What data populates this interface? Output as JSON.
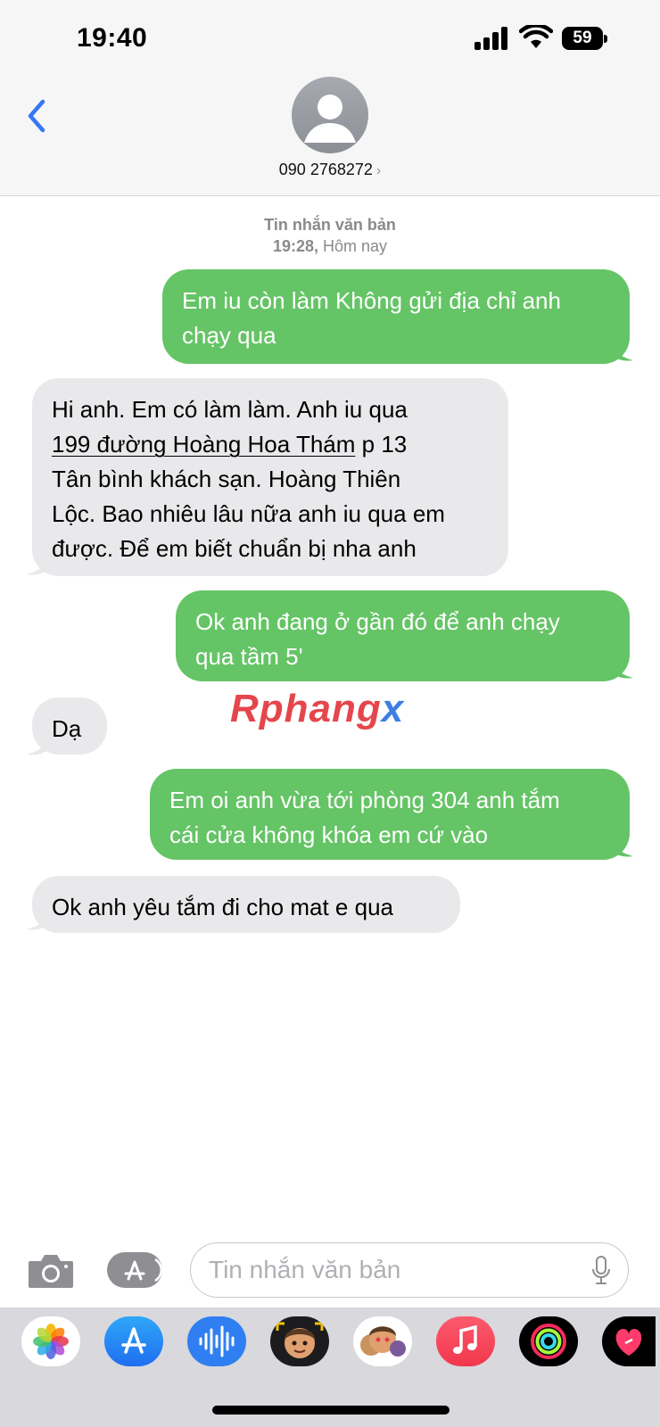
{
  "status_bar": {
    "time": "19:40",
    "battery": "59"
  },
  "header": {
    "contact": "090 2768272",
    "chevron": "›"
  },
  "timestamp": {
    "service": "Tin nhắn văn bản",
    "time_prefix": "19:28,",
    "time_day": "Hôm nay"
  },
  "messages": [
    {
      "dir": "sent",
      "lines": [
        "Em iu còn làm Không gửi địa chỉ anh",
        "chạy qua"
      ]
    },
    {
      "dir": "recv",
      "line1": "Hi anh. Em có làm làm. Anh iu qua",
      "address": "199 đường Hoàng Hoa Thám",
      "line2_rest": " p 13",
      "line3": "Tân bình khách sạn. Hoàng Thiên",
      "line4": "Lộc. Bao nhiêu lâu nữa anh iu qua em",
      "line5": "được. Để em biết chuẩn bị nha anh"
    },
    {
      "dir": "sent",
      "lines": [
        "Ok anh đang ở gần đó để anh chạy",
        "qua tầm 5'"
      ]
    },
    {
      "dir": "recv",
      "lines": [
        "Dạ"
      ]
    },
    {
      "dir": "sent",
      "lines": [
        "Em oi anh vừa tới phòng 304 anh tắm",
        "cái cửa không khóa em cứ vào"
      ]
    },
    {
      "dir": "recv",
      "lines": [
        "Ok anh yêu tắm đi cho mat e qua"
      ]
    }
  ],
  "watermark": {
    "part1": "Rphang",
    "part2": "x"
  },
  "composer": {
    "placeholder": "Tin nhắn văn bản"
  },
  "app_drawer": [
    "photos-icon",
    "app-store-icon",
    "audio-message-icon",
    "memoji-icon",
    "animoji-icon",
    "music-icon",
    "fitness-icon",
    "digital-touch-icon"
  ],
  "colors": {
    "sent_bubble": "#65c466",
    "recv_bubble": "#e9e9eb",
    "accent": "#3478f6"
  }
}
